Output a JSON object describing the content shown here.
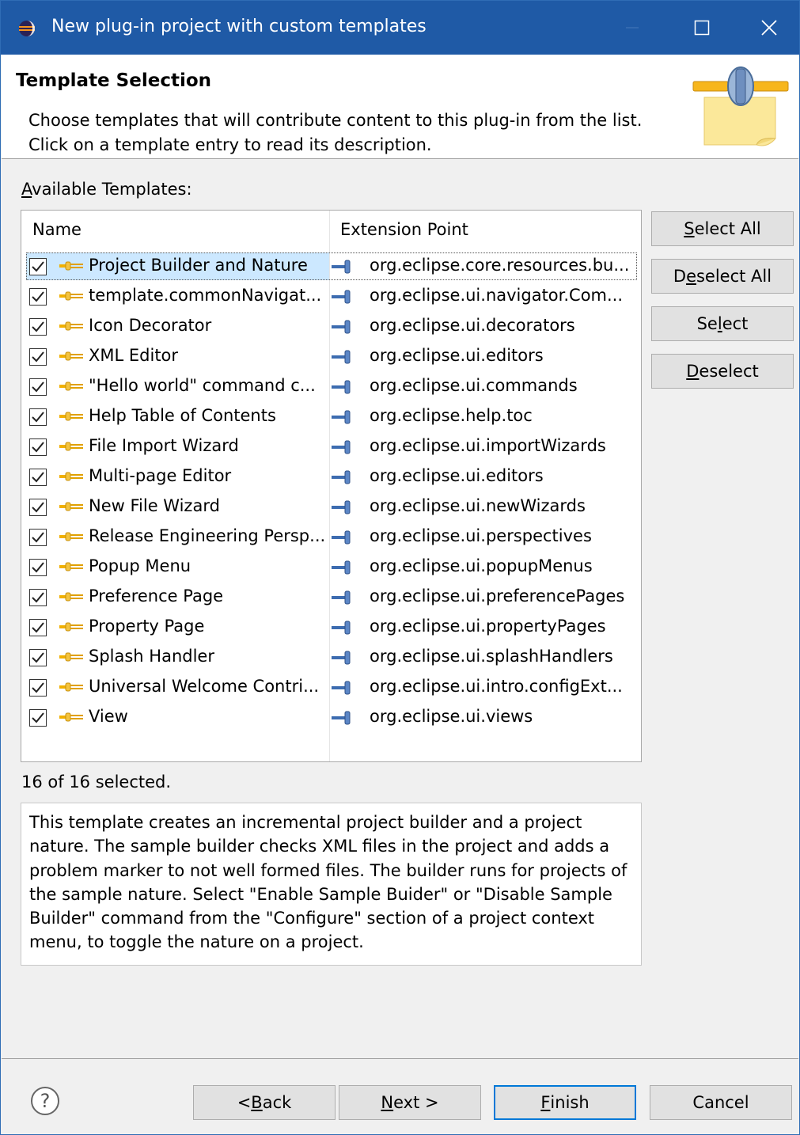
{
  "window": {
    "title": "New plug-in project with custom templates"
  },
  "header": {
    "heading": "Template Selection",
    "line1": "Choose templates that will contribute content to this plug-in from the list.",
    "line2": "Click on a template entry to read its description."
  },
  "available_label_first": "A",
  "available_label_rest": "vailable Templates:",
  "table": {
    "columns": [
      "Name",
      "Extension Point"
    ],
    "rows": [
      {
        "name": "Project Builder and Nature",
        "ep": "org.eclipse.core.resources.bu...",
        "checked": true,
        "selected": true
      },
      {
        "name": "template.commonNavigat...",
        "ep": "org.eclipse.ui.navigator.Com...",
        "checked": true
      },
      {
        "name": "Icon Decorator",
        "ep": "org.eclipse.ui.decorators",
        "checked": true
      },
      {
        "name": "XML Editor",
        "ep": "org.eclipse.ui.editors",
        "checked": true
      },
      {
        "name": "\"Hello world\" command c...",
        "ep": "org.eclipse.ui.commands",
        "checked": true
      },
      {
        "name": "Help Table of Contents",
        "ep": "org.eclipse.help.toc",
        "checked": true
      },
      {
        "name": "File Import Wizard",
        "ep": "org.eclipse.ui.importWizards",
        "checked": true
      },
      {
        "name": "Multi-page Editor",
        "ep": "org.eclipse.ui.editors",
        "checked": true
      },
      {
        "name": "New File Wizard",
        "ep": "org.eclipse.ui.newWizards",
        "checked": true
      },
      {
        "name": "Release Engineering Persp...",
        "ep": "org.eclipse.ui.perspectives",
        "checked": true
      },
      {
        "name": "Popup Menu",
        "ep": "org.eclipse.ui.popupMenus",
        "checked": true
      },
      {
        "name": "Preference Page",
        "ep": "org.eclipse.ui.preferencePages",
        "checked": true
      },
      {
        "name": "Property Page",
        "ep": "org.eclipse.ui.propertyPages",
        "checked": true
      },
      {
        "name": "Splash Handler",
        "ep": "org.eclipse.ui.splashHandlers",
        "checked": true
      },
      {
        "name": "Universal Welcome Contri...",
        "ep": "org.eclipse.ui.intro.configExt...",
        "checked": true
      },
      {
        "name": "View",
        "ep": "org.eclipse.ui.views",
        "checked": true
      }
    ]
  },
  "side_buttons": {
    "select_all": {
      "pre": "",
      "mn": "S",
      "post": "elect All"
    },
    "deselect_all": {
      "pre": "D",
      "mn": "e",
      "post": "select All"
    },
    "select": {
      "pre": "Se",
      "mn": "l",
      "post": "ect"
    },
    "deselect": {
      "pre": "",
      "mn": "D",
      "post": "eselect"
    }
  },
  "count_text": "16 of 16 selected.",
  "description": "This template creates an incremental project builder and a project nature. The sample builder checks XML files in the project and adds a problem marker to not well formed files. The builder runs for projects of the sample nature. Select \"Enable Sample Buider\" or \"Disable Sample Builder\" command from the \"Configure\" section of a project context menu, to toggle the nature on a project.",
  "footer": {
    "back": {
      "pre": "< ",
      "mn": "B",
      "post": "ack"
    },
    "next": {
      "pre": "",
      "mn": "N",
      "post": "ext >"
    },
    "finish": {
      "pre": "",
      "mn": "F",
      "post": "inish"
    },
    "cancel": "Cancel"
  },
  "colors": {
    "titlebar": "#1f5aa6",
    "selection": "#cce8ff",
    "default_button_border": "#0078d7"
  },
  "icons": {
    "app": "eclipse-icon",
    "template": "plug-icon",
    "extension_point": "extension-point-icon",
    "help": "help-icon"
  }
}
